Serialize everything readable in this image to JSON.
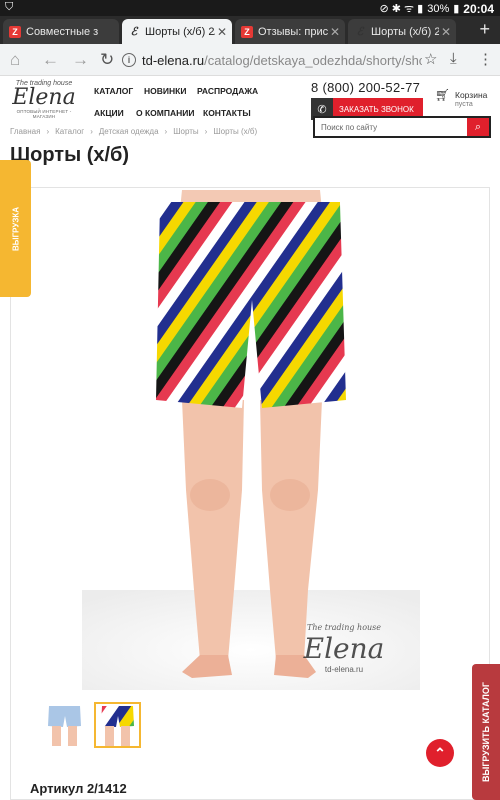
{
  "status_bar": {
    "battery": "30%",
    "time": "20:04"
  },
  "tabs": [
    {
      "label": "Совместные з",
      "favicon": "Z"
    },
    {
      "label": "Шорты (х/б) 2/",
      "favicon": "E"
    },
    {
      "label": "Отзывы: прис",
      "favicon": "Z"
    },
    {
      "label": "Шорты (х/б) 2/",
      "favicon": "E"
    }
  ],
  "address_bar": {
    "host": "td-elena.ru",
    "path": "/catalog/detskaya_odezhda/shorty/shc"
  },
  "site": {
    "logo_top": "The trading house",
    "logo_name": "Elena",
    "logo_tagline": "ОПТОВЫЙ ИНТЕРНЕТ - МАГАЗИН",
    "menu": [
      "КАТАЛОГ",
      "НОВИНКИ",
      "РАСПРОДАЖА",
      "АКЦИИ",
      "О КОМПАНИИ",
      "КОНТАКТЫ"
    ],
    "phone": "8 (800) 200-52-77",
    "call_button": "ЗАКАЗАТЬ ЗВОНОК",
    "cart_label": "Корзина",
    "cart_status": "пуста",
    "search_placeholder": "Поиск по сайту"
  },
  "breadcrumb": [
    "Главная",
    "Каталог",
    "Детская одежда",
    "Шорты",
    "Шорты (х/б)"
  ],
  "page_title": "Шорты (х/б)",
  "side_tab": "ВЫГРУЗКА",
  "watermark": {
    "top": "The trading house",
    "name": "Elena",
    "url": "td-elena.ru"
  },
  "article": "Артикул 2/1412",
  "download_tab": "ВЫГРУЗИТЬ КАТАЛОГ",
  "colors": {
    "brand_red": "#e0202c",
    "accent_yellow": "#f5b731",
    "download_tab": "#b83a3e"
  },
  "icons": [
    "shield-icon",
    "wifi-icon",
    "battery-icon",
    "back-icon",
    "forward-icon",
    "reload-icon",
    "info-icon",
    "star-icon",
    "download-icon",
    "more-icon",
    "cart-icon",
    "search-icon",
    "handset-icon",
    "chevron-up-icon"
  ]
}
